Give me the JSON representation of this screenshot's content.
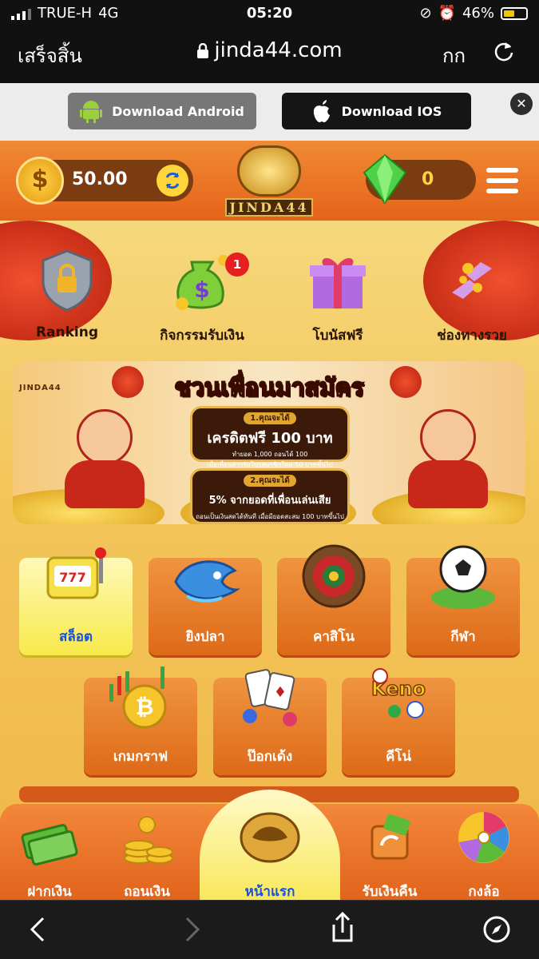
{
  "status_bar": {
    "carrier": "TRUE-H",
    "network": "4G",
    "time": "05:20",
    "battery": "46%"
  },
  "browser": {
    "done_label": "เสร็จสิ้น",
    "url": "jinda44.com",
    "text_size": "กก"
  },
  "download": {
    "android_label": "Download Android",
    "ios_label": "Download IOS"
  },
  "header": {
    "balance": "50.00",
    "gems": "0",
    "logo_text": "JINDA44"
  },
  "top_menu": [
    {
      "label": "Ranking"
    },
    {
      "label": "กิจกรรมรับเงิน",
      "badge": "1"
    },
    {
      "label": "โบนัสฟรี"
    },
    {
      "label": "ช่องทางรวย"
    }
  ],
  "banner": {
    "logo_text": "JINDA44",
    "title": "ชวนเพื่อนมาสมัคร",
    "step1_tag": "1.คุณจะได้",
    "step1_main": "เครดิตฟรี 100 บาท",
    "step1_sub1": "ทำยอด 1,000 ถอนได้ 100",
    "step1_sub2": "เมื่อเพื่อนฝากรับโปรสมาชิกใหม่ 50 บาทขึ้นไป",
    "step2_tag": "2.คุณจะได้",
    "step2_main": "5% จากยอดที่เพื่อนเล่นเสีย",
    "step2_sub": "ถอนเป็นเงินสดได้ทันที เมื่อมียอดสะสม 100 บาทขึ้นไป"
  },
  "games": [
    {
      "label": "สล็อต",
      "active": true
    },
    {
      "label": "ยิงปลา"
    },
    {
      "label": "คาสิโน"
    },
    {
      "label": "กีฬา"
    },
    {
      "label": "เกมกราฟ"
    },
    {
      "label": "ป๊อกเด้ง"
    },
    {
      "label": "คีโน่"
    }
  ],
  "bottom_nav": [
    {
      "label": "ฝากเงิน"
    },
    {
      "label": "ถอนเงิน"
    },
    {
      "label": "หน้าแรก"
    },
    {
      "label": "รับเงินคืน"
    },
    {
      "label": "กงล้อ"
    }
  ],
  "colors": {
    "header": "#e5631a",
    "page_bg": "#f3c55a",
    "active_tab": "#f8e85c",
    "active_text": "#1a4fd8"
  }
}
